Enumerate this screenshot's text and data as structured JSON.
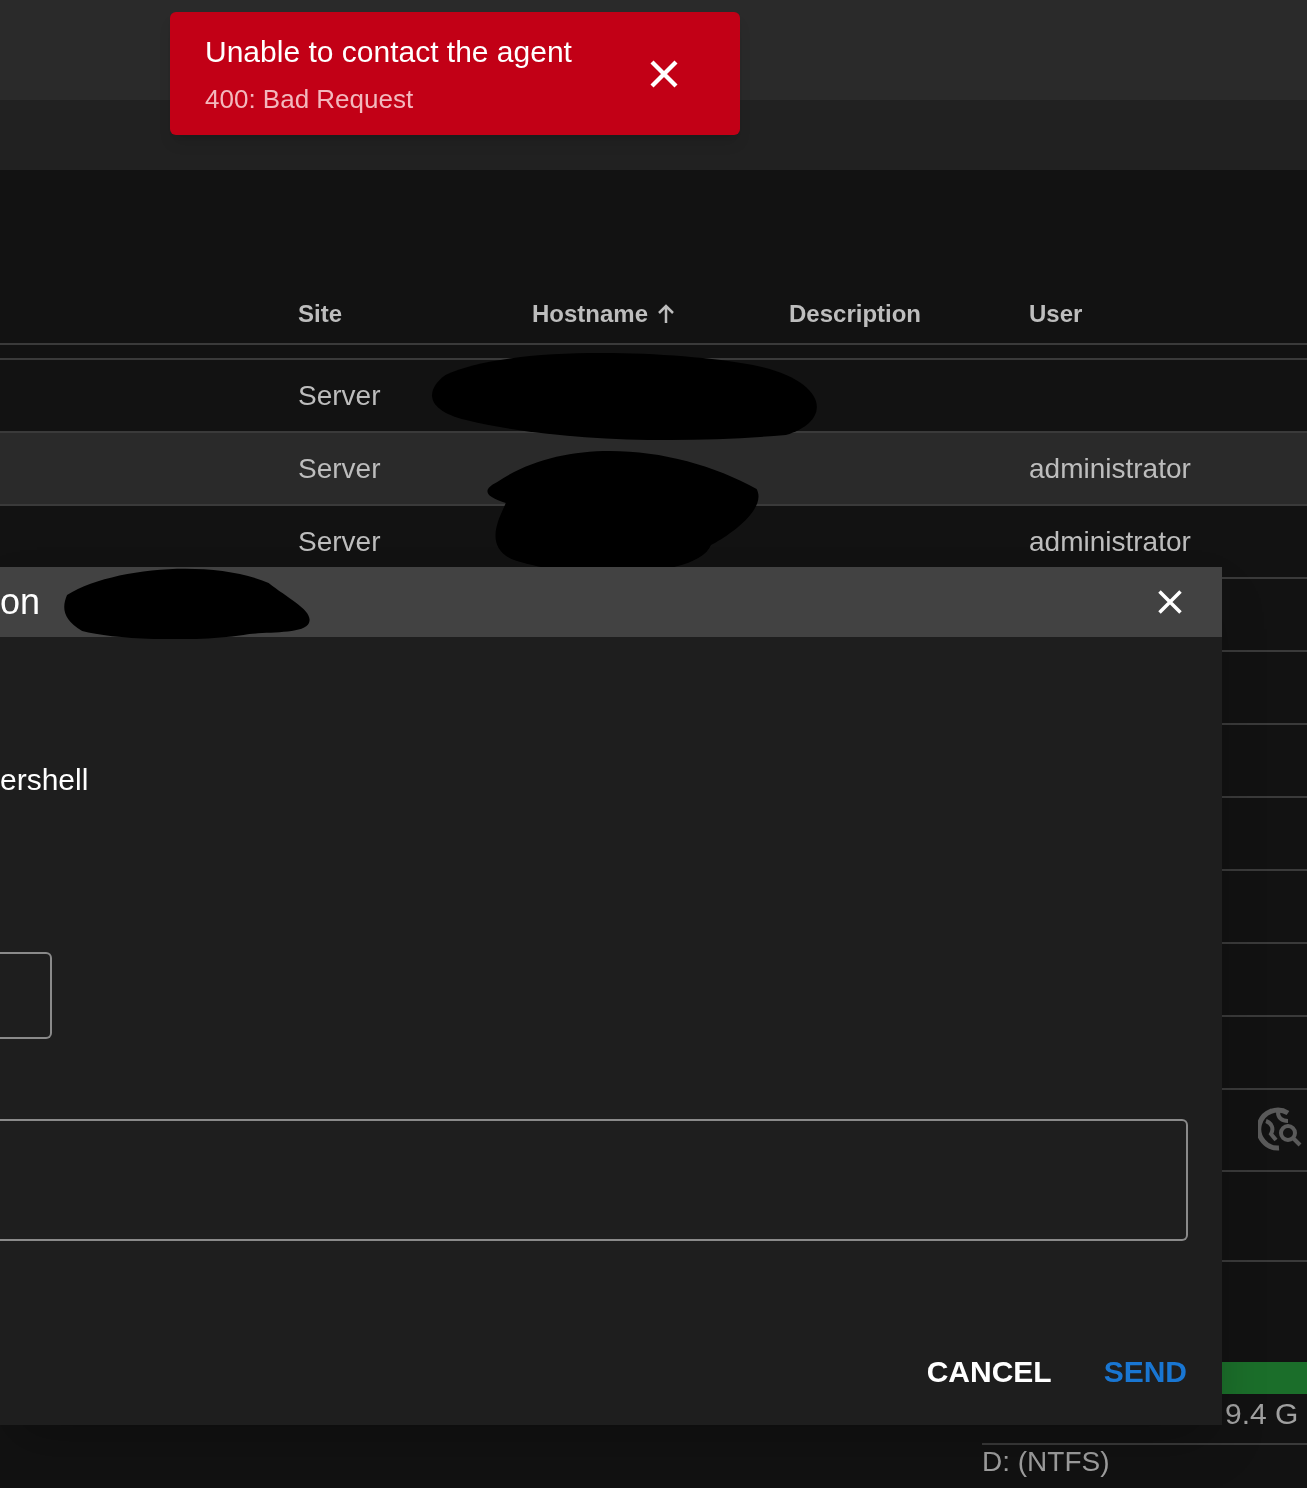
{
  "toast": {
    "title": "Unable to contact the agent",
    "message": "400: Bad Request"
  },
  "table": {
    "columns": [
      {
        "label": "Site",
        "sorted": false
      },
      {
        "label": "Hostname",
        "sorted": true
      },
      {
        "label": "Description",
        "sorted": false
      },
      {
        "label": "User",
        "sorted": false
      }
    ],
    "rows": [
      {
        "site": "Server",
        "highlighted": false
      },
      {
        "site": "Server",
        "user": "administrator",
        "highlighted": true
      },
      {
        "site": "Server",
        "user": "administrator",
        "highlighted": false
      }
    ]
  },
  "disk": {
    "free_text": "9.4 G",
    "drive": "D: (NTFS)"
  },
  "dialog": {
    "title": "on",
    "shell": "ershell",
    "buttons": [
      {
        "label": "CANCEL",
        "kind": "secondary"
      },
      {
        "label": "SEND",
        "kind": "primary"
      }
    ]
  }
}
